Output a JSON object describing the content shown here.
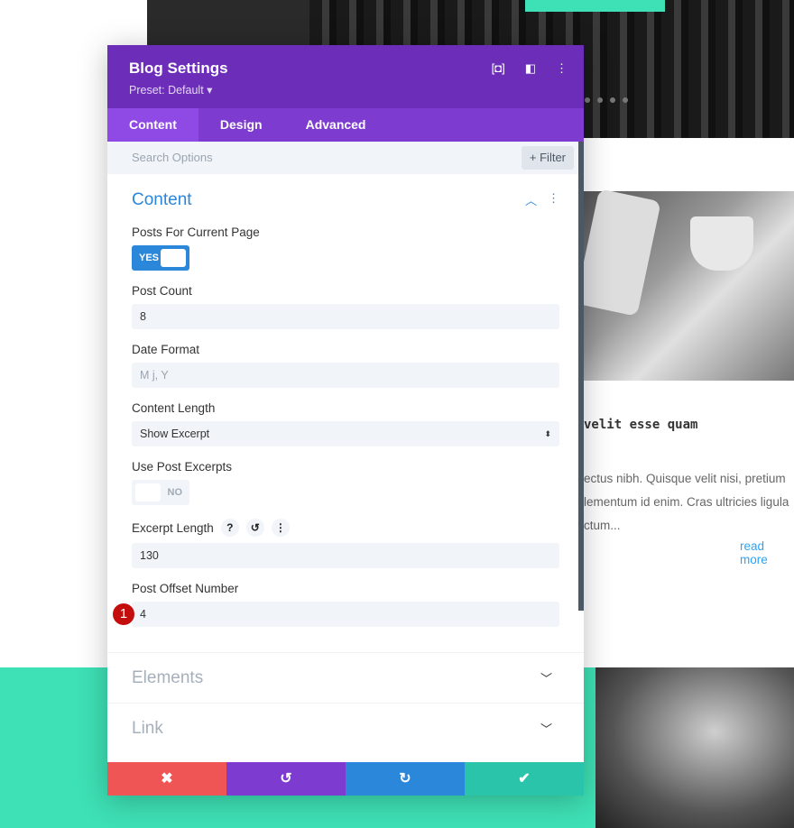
{
  "background": {
    "post_title": "velit esse quam",
    "post_excerpt_lines": [
      "ectus nibh. Quisque velit nisi, pretium",
      "lementum id enim. Cras ultricies ligula",
      "ctum..."
    ],
    "read_more": "read more"
  },
  "panel": {
    "title": "Blog Settings",
    "preset": "Preset: Default ▾",
    "icons": [
      "expand-icon",
      "sidebar-layout-icon",
      "more-vertical-icon"
    ],
    "tabs": [
      {
        "label": "Content",
        "active": true
      },
      {
        "label": "Design"
      },
      {
        "label": "Advanced"
      }
    ],
    "search_placeholder": "Search Options",
    "filter_label": "+ Filter",
    "section": {
      "title": "Content",
      "fields": {
        "posts_for_current_page": {
          "label": "Posts For Current Page",
          "value": "YES"
        },
        "post_count": {
          "label": "Post Count",
          "value": "8"
        },
        "date_format": {
          "label": "Date Format",
          "placeholder": "M j, Y"
        },
        "content_length": {
          "label": "Content Length",
          "value": "Show Excerpt"
        },
        "use_post_excerpts": {
          "label": "Use Post Excerpts",
          "value": "NO"
        },
        "excerpt_length": {
          "label": "Excerpt Length",
          "value": "130",
          "help": "?"
        },
        "post_offset": {
          "label": "Post Offset Number",
          "value": "4",
          "badge": "1"
        }
      }
    },
    "collapsed_sections": [
      "Elements",
      "Link"
    ],
    "footer": {
      "cancel": "✖",
      "undo": "↺",
      "redo": "↻",
      "save": "✔"
    },
    "colors": {
      "header": "#6c2eb9",
      "tabs": "#7d3bd0",
      "accent": "#2b87da",
      "cancel": "#ef5555",
      "undo": "#7e3bd0",
      "redo": "#2b87da",
      "save": "#29c4a9"
    }
  }
}
